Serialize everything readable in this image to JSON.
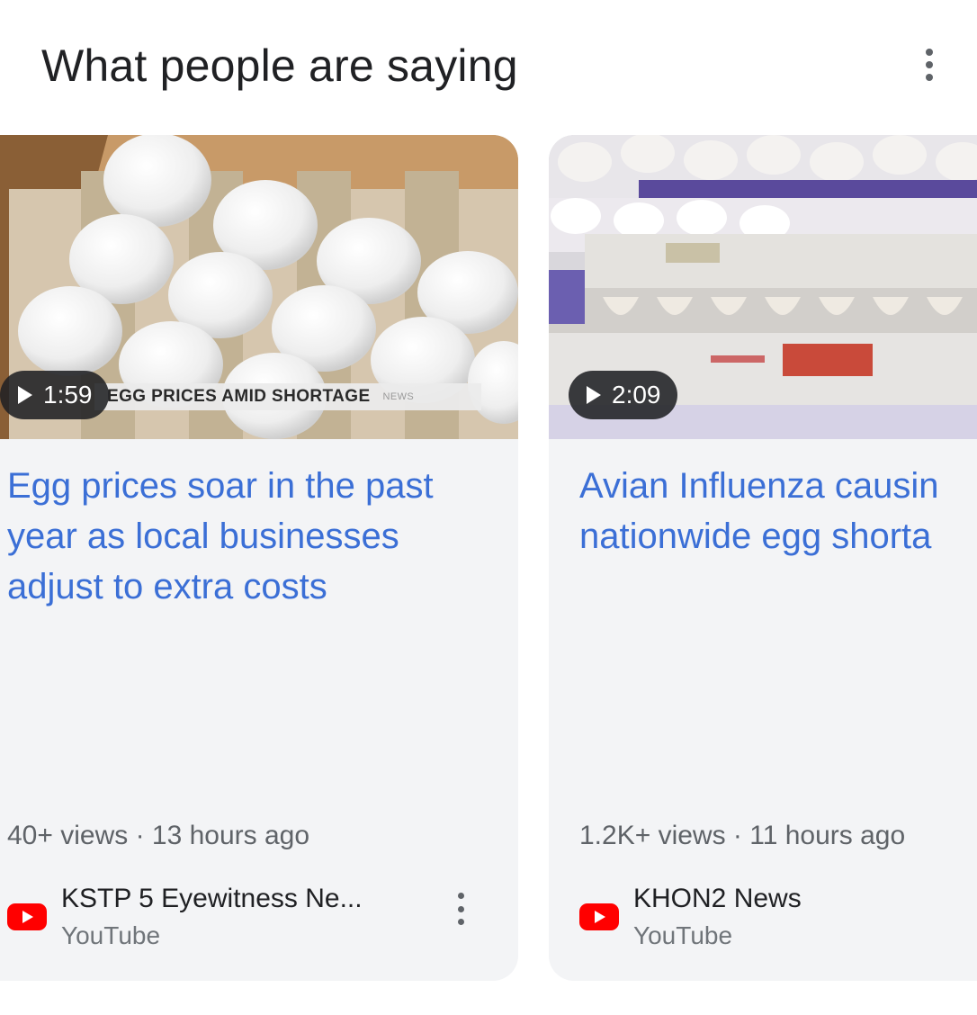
{
  "section": {
    "title": "What people are saying"
  },
  "cards": [
    {
      "duration": "1:59",
      "thumbnail_caption": "EGG PRICES AMID SHORTAGE",
      "thumbnail_tag": "NEWS",
      "title": "Egg prices soar in the past year as local businesses adjust to extra costs",
      "meta": "40+ views · 13 hours ago",
      "channel": "KSTP 5 Eyewitness Ne...",
      "platform": "YouTube"
    },
    {
      "duration": "2:09",
      "title_line1": "Avian Influenza causin",
      "title_line2": "nationwide egg shorta",
      "meta": "1.2K+ views · 11 hours ago",
      "channel": "KHON2 News",
      "platform": "YouTube"
    }
  ],
  "icons": {
    "more": "more-vert-icon",
    "play": "play-icon",
    "youtube": "youtube-icon"
  },
  "colors": {
    "link_title": "#3b6fd6",
    "card_bg": "#f3f4f6",
    "youtube_red": "#ff0000"
  }
}
